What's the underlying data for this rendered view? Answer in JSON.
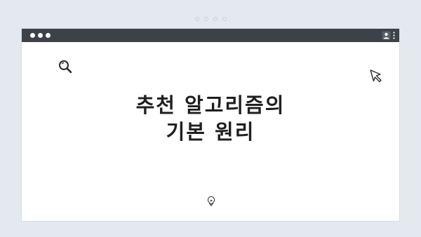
{
  "pager": {
    "dots": 4
  },
  "window": {
    "traffic_lights": [
      "close",
      "minimize",
      "zoom"
    ],
    "toolbar_icons": [
      "user-icon",
      "kebab-menu-icon"
    ]
  },
  "content": {
    "headline_line1": "추천 알고리즘의",
    "headline_line2": "기본 원리",
    "icons": [
      "search-icon",
      "cursor-icon",
      "lightbulb-icon"
    ]
  },
  "colors": {
    "background": "#e4e9ef",
    "titlebar": "#3d4148",
    "text": "#1f1f1f"
  }
}
